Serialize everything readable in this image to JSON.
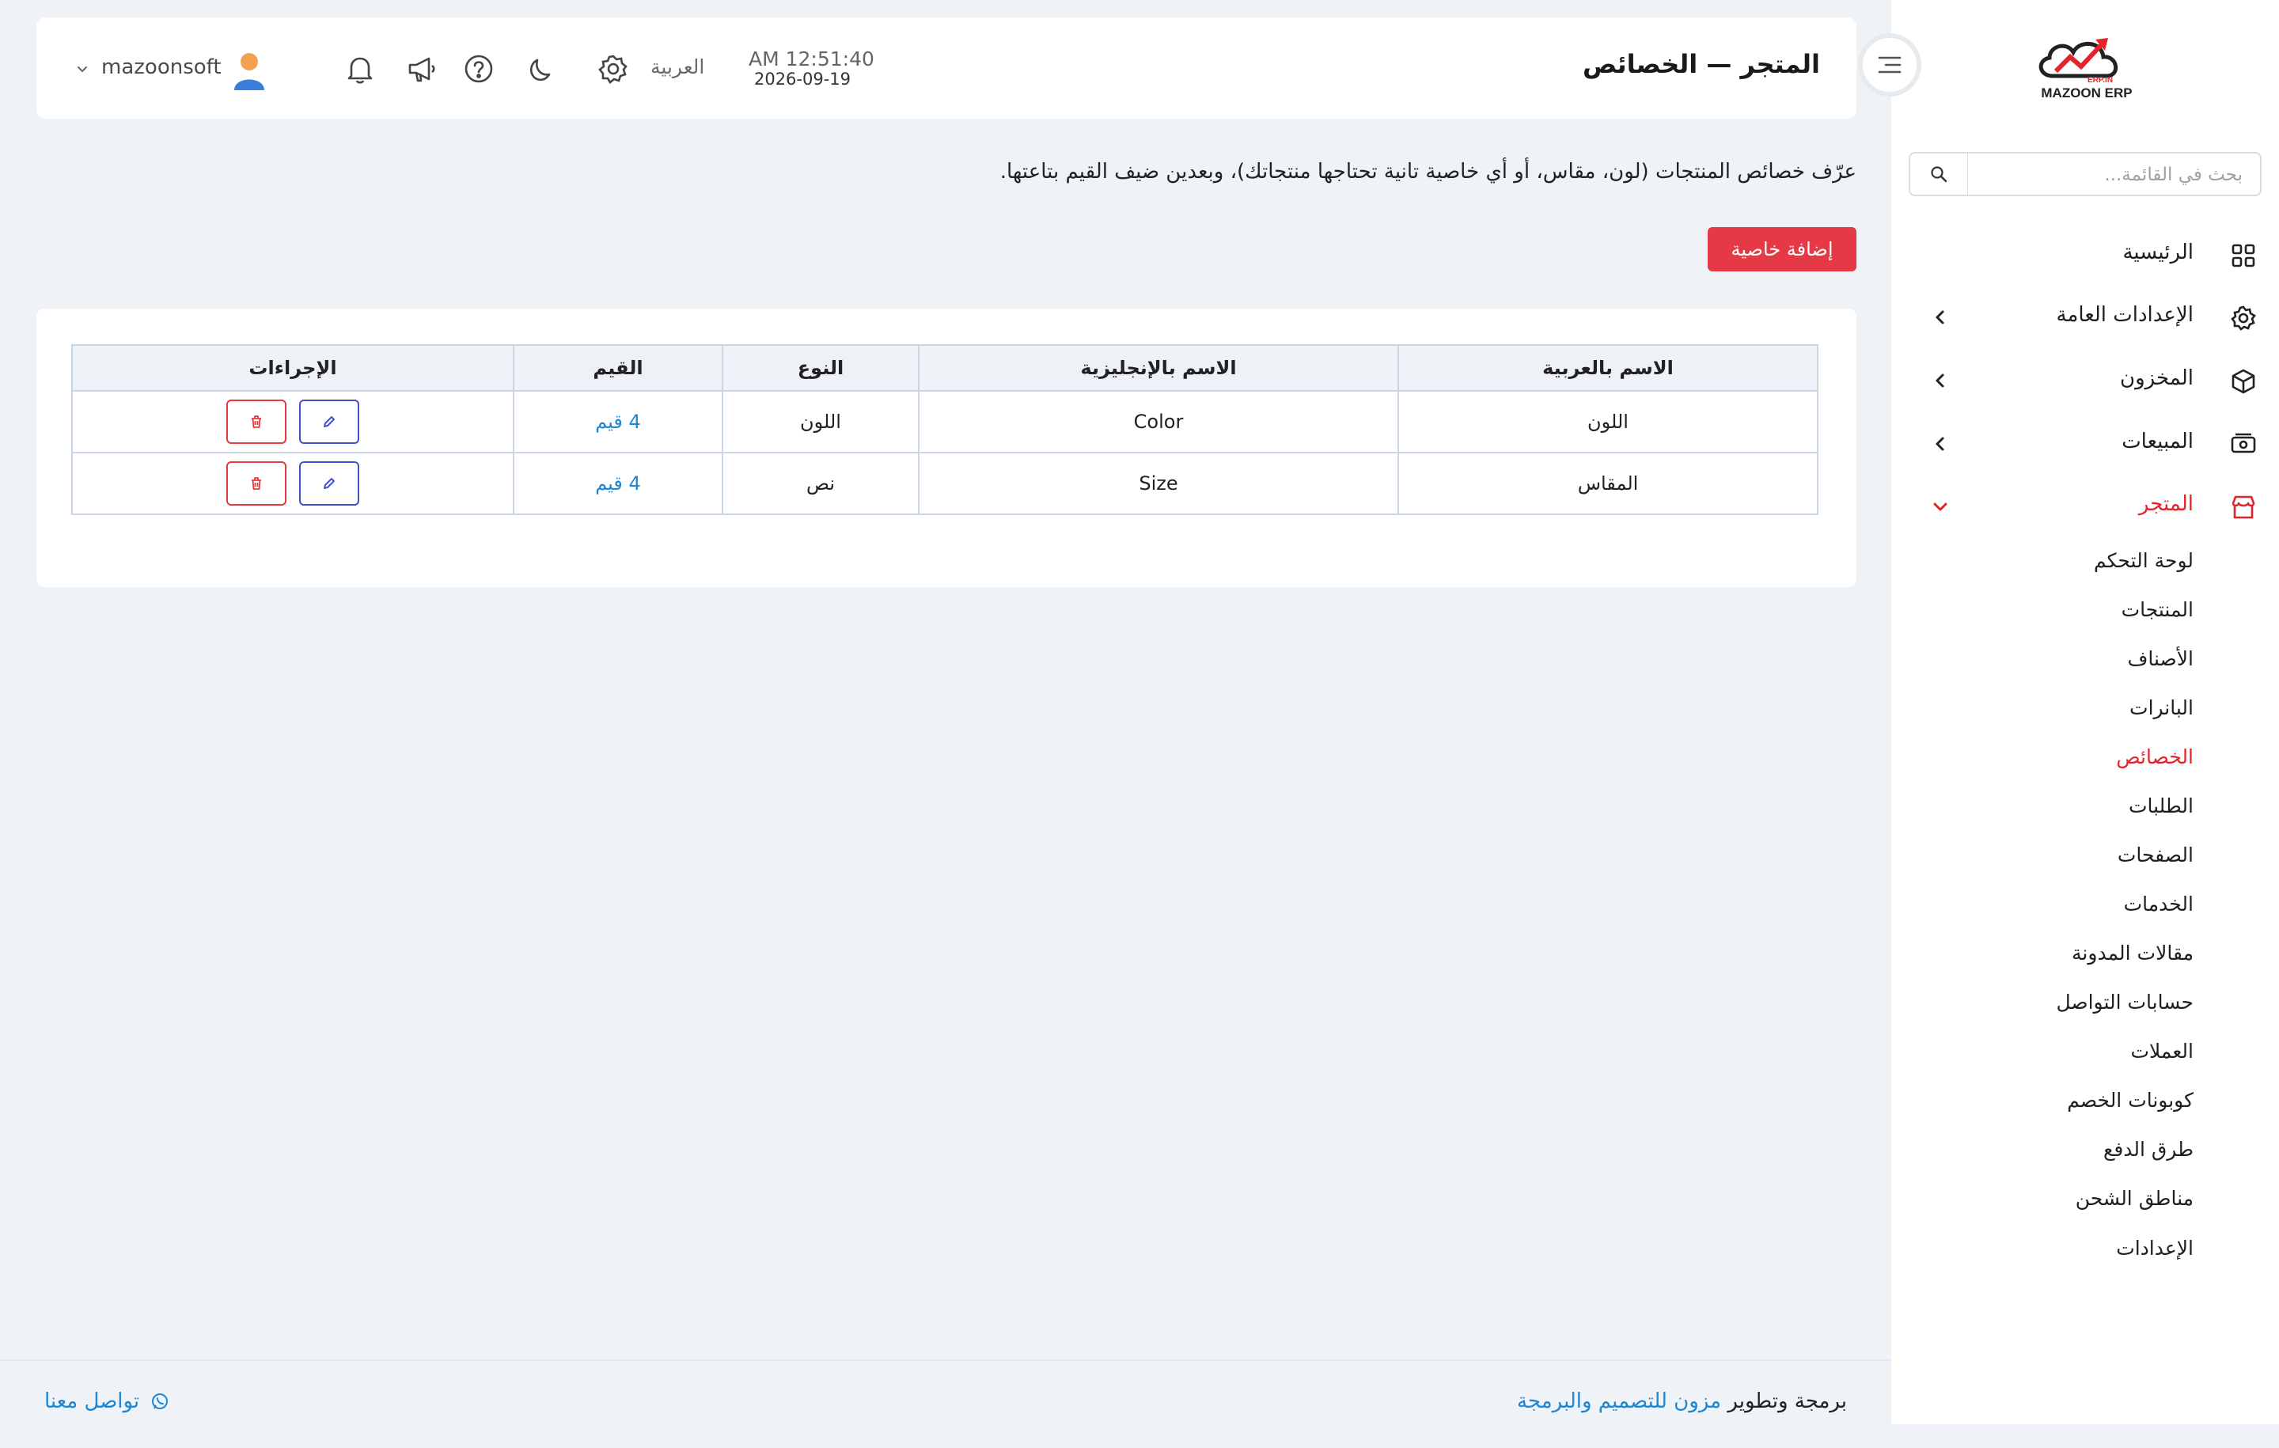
{
  "app": {
    "logo_text": "MAZOON ERP",
    "logo_sub": "ERP.IN"
  },
  "header": {
    "title": "المتجر — الخصائص",
    "username": "mazoonsoft",
    "language": "العربية",
    "time": "AM 12:51:40",
    "date": "2026-09-19",
    "icons": [
      "bell-icon",
      "megaphone-icon",
      "help-icon",
      "moon-icon",
      "gear-icon"
    ]
  },
  "sidebar": {
    "search_placeholder": "بحث في القائمة...",
    "items": [
      {
        "label": "الرئيسية",
        "icon": "grid-icon"
      },
      {
        "label": "الإعدادات العامة",
        "icon": "gear-icon"
      },
      {
        "label": "المخزون",
        "icon": "box-icon"
      },
      {
        "label": "المبيعات",
        "icon": "cash-icon"
      },
      {
        "label": "المتجر",
        "icon": "store-icon",
        "active": true
      }
    ],
    "store_subitems": [
      {
        "label": "لوحة التحكم"
      },
      {
        "label": "المنتجات"
      },
      {
        "label": "الأصناف"
      },
      {
        "label": "البانرات"
      },
      {
        "label": "الخصائص",
        "active": true
      },
      {
        "label": "الطلبات"
      },
      {
        "label": "الصفحات"
      },
      {
        "label": "الخدمات"
      },
      {
        "label": "مقالات المدونة"
      },
      {
        "label": "حسابات التواصل"
      },
      {
        "label": "العملات"
      },
      {
        "label": "كوبونات الخصم"
      },
      {
        "label": "طرق الدفع"
      },
      {
        "label": "مناطق الشحن"
      },
      {
        "label": "الإعدادات"
      }
    ]
  },
  "content": {
    "description": "عرّف خصائص المنتجات (لون، مقاس، أو أي خاصية تانية تحتاجها منتجاتك)، وبعدين ضيف القيم بتاعتها.",
    "add_button": "إضافة خاصية",
    "table": {
      "headers": [
        "الاسم بالعربية",
        "الاسم بالإنجليزية",
        "النوع",
        "القيم",
        "الإجراءات"
      ],
      "rows": [
        {
          "name_ar": "اللون",
          "name_en": "Color",
          "type": "اللون",
          "values": "4 قيم"
        },
        {
          "name_ar": "المقاس",
          "name_en": "Size",
          "type": "نص",
          "values": "4 قيم"
        }
      ]
    }
  },
  "footer": {
    "credit_prefix": "برمجة وتطوير",
    "credit_link": "مزون للتصميم والبرمجة",
    "contact": "تواصل معنا"
  },
  "colors": {
    "accent": "#e3242b",
    "button": "#e63946",
    "link": "#1f86d1",
    "edit": "#4352c4"
  }
}
